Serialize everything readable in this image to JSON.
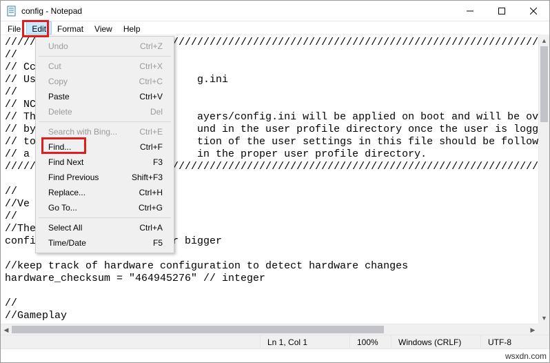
{
  "window": {
    "title": "config - Notepad"
  },
  "menubar": {
    "file": "File",
    "edit": "Edit",
    "format": "Format",
    "view": "View",
    "help": "Help"
  },
  "edit_menu": {
    "undo": {
      "label": "Undo",
      "shortcut": "Ctrl+Z"
    },
    "cut": {
      "label": "Cut",
      "shortcut": "Ctrl+X"
    },
    "copy": {
      "label": "Copy",
      "shortcut": "Ctrl+C"
    },
    "paste": {
      "label": "Paste",
      "shortcut": "Ctrl+V"
    },
    "delete": {
      "label": "Delete",
      "shortcut": "Del"
    },
    "search_bing": {
      "label": "Search with Bing...",
      "shortcut": "Ctrl+E"
    },
    "find": {
      "label": "Find...",
      "shortcut": "Ctrl+F"
    },
    "find_next": {
      "label": "Find Next",
      "shortcut": "F3"
    },
    "find_prev": {
      "label": "Find Previous",
      "shortcut": "Shift+F3"
    },
    "replace": {
      "label": "Replace...",
      "shortcut": "Ctrl+H"
    },
    "goto": {
      "label": "Go To...",
      "shortcut": "Ctrl+G"
    },
    "select_all": {
      "label": "Select All",
      "shortcut": "Ctrl+A"
    },
    "time_date": {
      "label": "Time/Date",
      "shortcut": "F5"
    }
  },
  "editor": {
    "lines": [
      "//////////////////////////////////////////////////////////////////////////////////////////////",
      "//",
      "// Cc",
      "// Us                          g.ini",
      "//",
      "// NC",
      "// Th                          ayers/config.ini will be applied on boot and will be overridden",
      "// by                          und in the user profile directory once the user is logged in",
      "// to                          tion of the user settings in this file should be followed by",
      "// a                           in the proper user profile directory.",
      "//////////////////////////////////////////////////////////////////////////////////////////////",
      "",
      "//",
      "//Ve",
      "//",
      "//The",
      "config_version = \"7\" // 0 or bigger",
      "",
      "//keep track of hardware configuration to detect hardware changes",
      "hardware_checksum = \"464945276\" // integer",
      "",
      "//",
      "//Gameplay"
    ]
  },
  "statusbar": {
    "lncol": "Ln 1, Col 1",
    "zoom": "100%",
    "line_ending": "Windows (CRLF)",
    "encoding": "UTF-8"
  },
  "watermark": "wsxdn.com"
}
